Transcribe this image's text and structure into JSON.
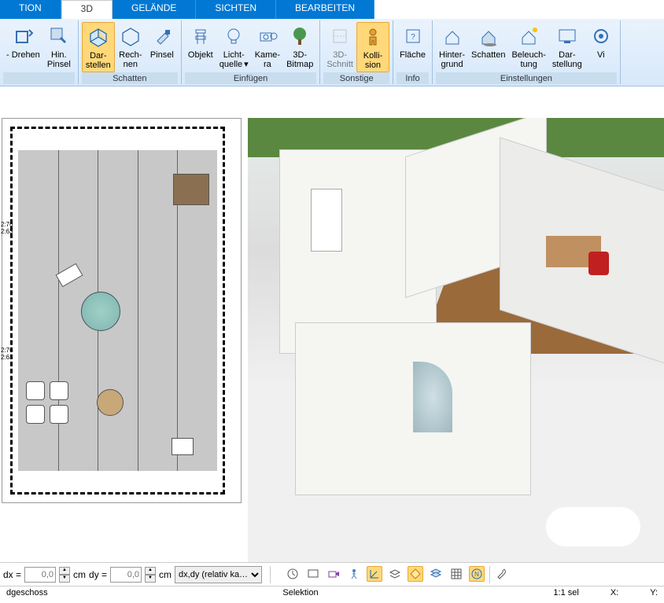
{
  "tabs": {
    "t0": "TION",
    "t1": "3D",
    "t2": "GELÄNDE",
    "t3": "SICHTEN",
    "t4": "BEARBEITEN"
  },
  "ribbon": {
    "g0": {
      "gtitle": "",
      "btns": {
        "b0": "- Drehen",
        "b1": "Hin.\nPinsel"
      }
    },
    "g1": {
      "gtitle": "Schatten",
      "btns": {
        "b0": "Dar-\nstellen",
        "b1": "Rech-\nnen",
        "b2": "Pinsel"
      }
    },
    "g2": {
      "gtitle": "Einfügen",
      "btns": {
        "b0": "Objekt",
        "b1": "Licht-\nquelle",
        "b2": "Kame-\nra",
        "b3": "3D-\nBitmap"
      }
    },
    "g3": {
      "gtitle": "Sonstige",
      "btns": {
        "b0": "3D-\nSchnitt",
        "b1": "Kolli-\nsion"
      }
    },
    "g4": {
      "gtitle": "Info",
      "btns": {
        "b0": "Fläche"
      }
    },
    "g5": {
      "gtitle": "Einstellungen",
      "btns": {
        "b0": "Hinter-\ngrund",
        "b1": "Schatten",
        "b2": "Beleuch-\ntung",
        "b3": "Dar-\nstellung",
        "b4": "Vi"
      }
    }
  },
  "coord": {
    "dx_label": "dx =",
    "dy_label": "dy =",
    "unit": "cm",
    "placeholder": "0,0",
    "mode": "dx,dy (relativ ka…"
  },
  "status": {
    "floor": "dgeschoss",
    "selektion": "Selektion",
    "ratio": "1:1 sel",
    "x": "X:",
    "y": "Y:"
  }
}
